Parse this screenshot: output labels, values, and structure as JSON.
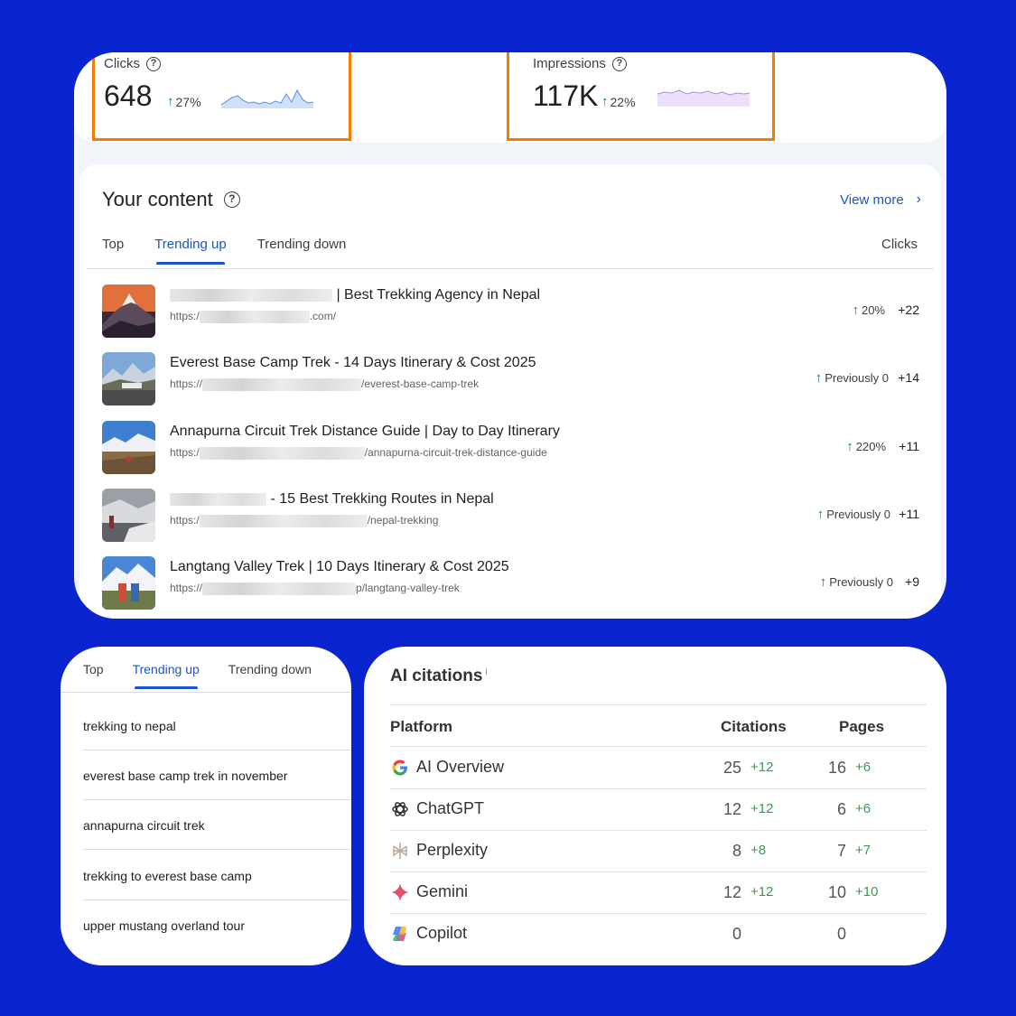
{
  "metrics": {
    "clicks": {
      "label": "Clicks",
      "value": "648",
      "delta": "27%"
    },
    "impressions": {
      "label": "Impressions",
      "value": "117K",
      "delta": "22%"
    }
  },
  "content": {
    "title": "Your content",
    "view_more": "View more",
    "tabs": [
      "Top",
      "Trending up",
      "Trending down"
    ],
    "active_tab": "Trending up",
    "clicks_header": "Clicks",
    "rows": [
      {
        "title_visible": "| Best Trekking Agency in Nepal",
        "url_prefix": "https:/",
        "url_suffix": ".com/",
        "change": "20%",
        "clicks": "+22"
      },
      {
        "title_visible": "Everest Base Camp Trek - 14 Days Itinerary & Cost 2025",
        "url_prefix": "https://",
        "url_suffix": "/everest-base-camp-trek",
        "change": "Previously 0",
        "clicks": "+14"
      },
      {
        "title_visible": "Annapurna Circuit Trek Distance Guide | Day to Day Itinerary",
        "url_prefix": "https:/",
        "url_suffix": "/annapurna-circuit-trek-distance-guide",
        "change": "220%",
        "clicks": "+11"
      },
      {
        "title_visible": "- 15 Best Trekking Routes in Nepal",
        "url_prefix": "https:/",
        "url_suffix": "/nepal-trekking",
        "change": "Previously 0",
        "clicks": "+11"
      },
      {
        "title_visible": "Langtang Valley Trek | 10 Days Itinerary & Cost 2025",
        "url_prefix": "https://",
        "url_suffix": "p/langtang-valley-trek",
        "change": "Previously 0",
        "clicks": "+9"
      }
    ]
  },
  "queries": {
    "tabs": [
      "Top",
      "Trending up",
      "Trending down"
    ],
    "active_tab": "Trending up",
    "items": [
      "trekking to nepal",
      "everest base camp trek in november",
      "annapurna circuit trek",
      "trekking to everest base camp",
      "upper mustang overland tour"
    ]
  },
  "ai_citations": {
    "title": "AI citations",
    "info": "i",
    "headers": {
      "platform": "Platform",
      "citations": "Citations",
      "pages": "Pages"
    },
    "rows": [
      {
        "icon": "google-icon",
        "name": "AI Overview",
        "citations": "25",
        "citations_delta": "+12",
        "pages": "16",
        "pages_delta": "+6"
      },
      {
        "icon": "chatgpt-icon",
        "name": "ChatGPT",
        "citations": "12",
        "citations_delta": "+12",
        "pages": "6",
        "pages_delta": "+6"
      },
      {
        "icon": "perplexity-icon",
        "name": "Perplexity",
        "citations": "8",
        "citations_delta": "+8",
        "pages": "7",
        "pages_delta": "+7"
      },
      {
        "icon": "gemini-icon",
        "name": "Gemini",
        "citations": "12",
        "citations_delta": "+12",
        "pages": "10",
        "pages_delta": "+10"
      },
      {
        "icon": "copilot-icon",
        "name": "Copilot",
        "citations": "0",
        "citations_delta": "",
        "pages": "0",
        "pages_delta": ""
      }
    ]
  },
  "colors": {
    "background": "#0a24cf",
    "accent": "#1a55c9",
    "highlight": "#f57c00",
    "positive": "#188038"
  }
}
